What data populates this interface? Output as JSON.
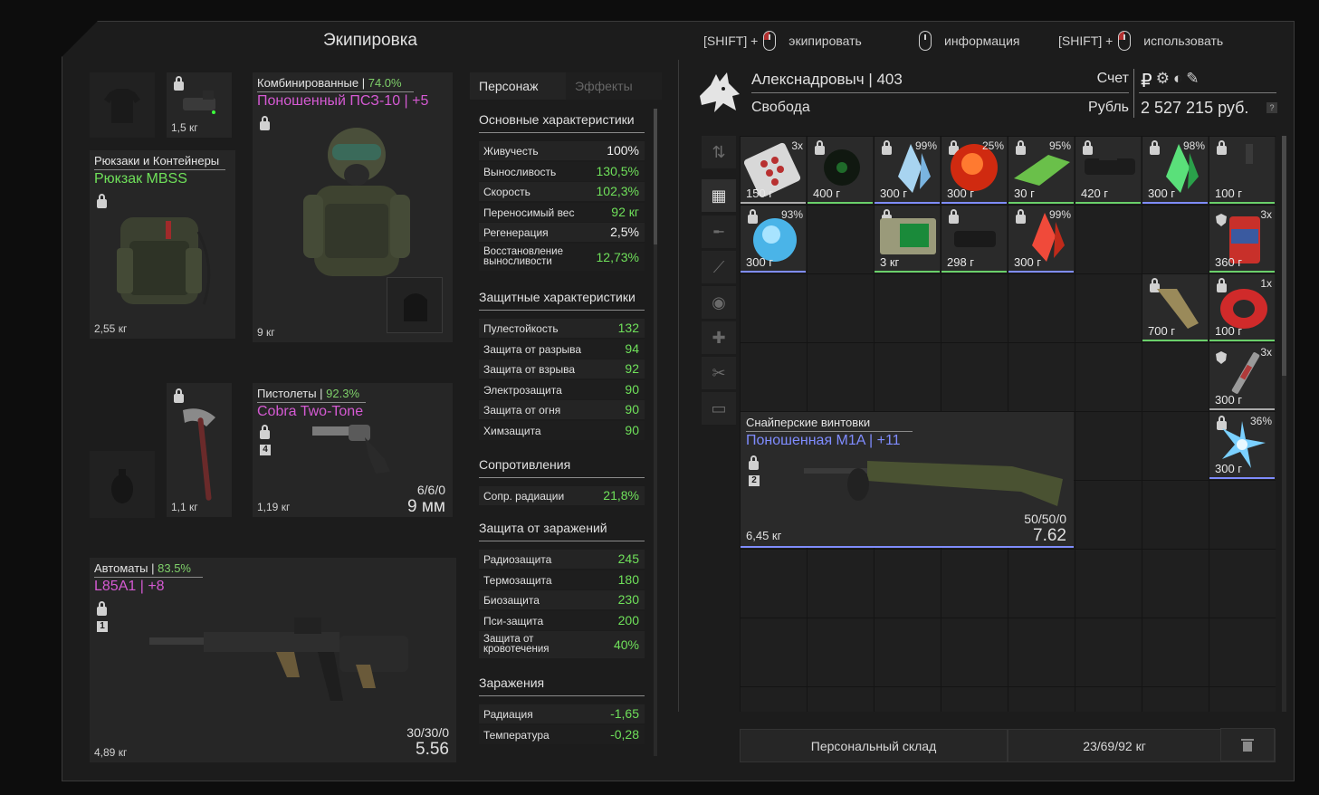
{
  "title": "Экипировка",
  "hints": [
    {
      "prefix": "[SHIFT] +",
      "mouse": "left",
      "label": "экипировать"
    },
    {
      "prefix": "",
      "mouse": "plain",
      "label": "информация"
    },
    {
      "prefix": "[SHIFT] +",
      "mouse": "left",
      "label": "использовать"
    }
  ],
  "equipment": {
    "device_weight": "1,5 кг",
    "backpack": {
      "category": "Рюкзаки и Контейнеры",
      "name": "Рюкзак MBSS",
      "weight": "2,55 кг"
    },
    "armor": {
      "category": "Комбинированные",
      "percent": "74.0%",
      "name": "Поношенный ПСЗ-10 | +5",
      "weight": "9 кг"
    },
    "melee": {
      "weight": "1,1 кг"
    },
    "pistol": {
      "category": "Пистолеты",
      "percent": "92.3%",
      "name": "Cobra Two-Tone",
      "badge": "4",
      "ammo": "6/6/0",
      "caliber": "9 мм",
      "weight": "1,19 кг"
    },
    "rifle": {
      "category": "Автоматы",
      "percent": "83.5%",
      "name": "L85A1 | +8",
      "badge": "1",
      "ammo": "30/30/0",
      "caliber": "5.56",
      "weight": "4,89 кг"
    }
  },
  "tabs": {
    "character": "Персонаж",
    "effects": "Эффекты"
  },
  "stats": {
    "main_title": "Основные характеристики",
    "main": [
      {
        "k": "Живучесть",
        "v": "100%",
        "c": "white"
      },
      {
        "k": "Выносливость",
        "v": "130,5%",
        "c": "green"
      },
      {
        "k": "Скорость",
        "v": "102,3%",
        "c": "green"
      },
      {
        "k": "Переносимый вес",
        "v": "92 кг",
        "c": "green"
      },
      {
        "k": "Регенерация",
        "v": "2,5%",
        "c": "white"
      },
      {
        "k": "Восстановление выносливости",
        "v": "12,73%",
        "c": "green"
      }
    ],
    "prot_title": "Защитные характеристики",
    "prot": [
      {
        "k": "Пулестойкость",
        "v": "132"
      },
      {
        "k": "Защита от разрыва",
        "v": "94"
      },
      {
        "k": "Защита от взрыва",
        "v": "92"
      },
      {
        "k": "Электрозащита",
        "v": "90"
      },
      {
        "k": "Защита от огня",
        "v": "90"
      },
      {
        "k": "Химзащита",
        "v": "90"
      }
    ],
    "res_title": "Сопротивления",
    "res": [
      {
        "k": "Сопр. радиации",
        "v": "21,8%"
      }
    ],
    "inf_title": "Защита от заражений",
    "inf": [
      {
        "k": "Радиозащита",
        "v": "245"
      },
      {
        "k": "Термозащита",
        "v": "180"
      },
      {
        "k": "Биозащита",
        "v": "230"
      },
      {
        "k": "Пси-защита",
        "v": "200"
      },
      {
        "k": "Защита от кровотечения",
        "v": "40%"
      }
    ],
    "cont_title": "Заражения",
    "cont": [
      {
        "k": "Радиация",
        "v": "-1,65"
      },
      {
        "k": "Температура",
        "v": "-0,28"
      }
    ]
  },
  "player": {
    "name": "Алекснадровыч | 403",
    "group": "Свобода",
    "account_label": "Счет",
    "currency_label": "Рубль",
    "money": "2 527 215 руб.",
    "help": "?"
  },
  "header_icons": [
    "₽",
    "⚙",
    "◐",
    "✎"
  ],
  "filters": [
    "sort-icon",
    "grid-icon",
    "rifle-icon",
    "knife-icon",
    "artifact-icon",
    "medkit-icon",
    "tools-icon",
    "box-icon"
  ],
  "filter_glyphs": [
    "⇅",
    "▦",
    "╾",
    "⟋",
    "◉",
    "✚",
    "✂",
    "▭"
  ],
  "inventory": [
    {
      "top": "3x",
      "price": "150 г",
      "lock": false,
      "shield": true
    },
    {
      "top": "",
      "price": "400 г",
      "lock": true
    },
    {
      "top": "99%",
      "price": "300 г",
      "lock": true
    },
    {
      "top": "25%",
      "price": "300 г",
      "lock": true
    },
    {
      "top": "95%",
      "price": "30 г",
      "lock": true
    },
    {
      "top": "",
      "price": "420 г",
      "lock": true
    },
    {
      "top": "98%",
      "price": "300 г",
      "lock": true
    },
    {
      "top": "",
      "price": "100 г",
      "lock": true
    },
    {
      "top": "93%",
      "price": "300 г",
      "lock": true
    },
    {
      "top": "",
      "price": "3 кг",
      "lock": true
    },
    {
      "top": "",
      "price": "298 г",
      "lock": true
    },
    {
      "top": "99%",
      "price": "300 г",
      "lock": true
    },
    {
      "top": "3x",
      "price": "360 г",
      "lock": false,
      "shield": true
    },
    {
      "top": "",
      "price": "700 г",
      "lock": true
    },
    {
      "top": "1x",
      "price": "100 г",
      "lock": true
    },
    {
      "top": "3x",
      "price": "300 г",
      "lock": false,
      "shield": true
    },
    {
      "top": "36%",
      "price": "300 г",
      "lock": true
    }
  ],
  "sniper": {
    "category": "Снайперские винтовки",
    "name": "Поношенная M1A | +11",
    "badge": "2",
    "ammo": "50/50/0",
    "caliber": "7.62",
    "weight": "6,45 кг"
  },
  "footer": {
    "storage": "Персональный склад",
    "weight": "23/69/92 кг"
  }
}
